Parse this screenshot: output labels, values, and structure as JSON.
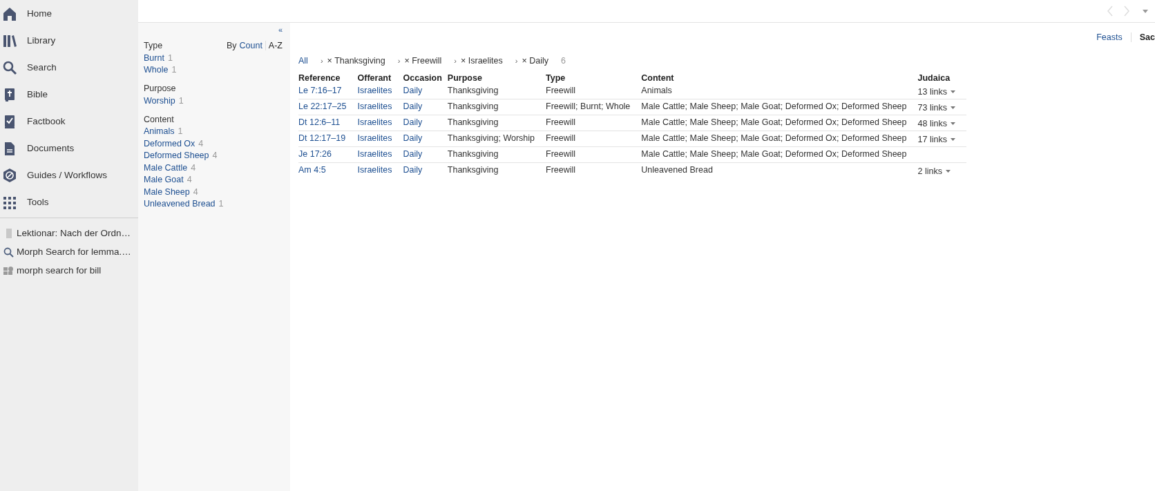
{
  "sidebar": {
    "nav_items": [
      {
        "label": "Home"
      },
      {
        "label": "Library"
      },
      {
        "label": "Search"
      },
      {
        "label": "Bible"
      },
      {
        "label": "Factbook"
      },
      {
        "label": "Documents"
      },
      {
        "label": "Guides / Workflows"
      },
      {
        "label": "Tools"
      }
    ],
    "recent_items": [
      {
        "label": "Lektionar: Nach der Ordn…"
      },
      {
        "label": "Morph Search for lemma.…"
      },
      {
        "label": "morph search for bill"
      }
    ]
  },
  "filter_panel": {
    "collapse": "«",
    "sort_label": "By",
    "sort_options": [
      {
        "label": "Count",
        "selected": false
      },
      {
        "label": "A-Z",
        "selected": true
      }
    ],
    "groups": [
      {
        "title": "Type",
        "items": [
          {
            "label": "Burnt",
            "count": "1"
          },
          {
            "label": "Whole",
            "count": "1"
          }
        ]
      },
      {
        "title": "Purpose",
        "items": [
          {
            "label": "Worship",
            "count": "1"
          }
        ]
      },
      {
        "title": "Content",
        "items": [
          {
            "label": "Animals",
            "count": "1"
          },
          {
            "label": "Deformed Ox",
            "count": "4"
          },
          {
            "label": "Deformed Sheep",
            "count": "4"
          },
          {
            "label": "Male Cattle",
            "count": "4"
          },
          {
            "label": "Male Goat",
            "count": "4"
          },
          {
            "label": "Male Sheep",
            "count": "4"
          },
          {
            "label": "Unleavened Bread",
            "count": "1"
          }
        ]
      }
    ]
  },
  "tabs": [
    {
      "label": "Feasts",
      "selected": false
    },
    {
      "label": "Sac",
      "selected": true
    }
  ],
  "breadcrumb": {
    "root": "All",
    "filters": [
      {
        "separator": "›",
        "label": "× Thanksgiving"
      },
      {
        "separator": "›",
        "label": "× Freewill"
      },
      {
        "separator": "›",
        "label": "× Israelites"
      },
      {
        "separator": "›",
        "label": "× Daily"
      }
    ],
    "count": "6"
  },
  "table": {
    "columns": [
      {
        "label": "Reference",
        "kind": "link"
      },
      {
        "label": "Offerant",
        "kind": "link"
      },
      {
        "label": "Occasion",
        "kind": "link"
      },
      {
        "label": "Purpose",
        "kind": "text"
      },
      {
        "label": "Type",
        "kind": "text"
      },
      {
        "label": "Content",
        "kind": "text"
      },
      {
        "label": "Judaica",
        "kind": "dropdown"
      }
    ],
    "rows": [
      {
        "cells": [
          "Le 7:16–17",
          "Israelites",
          "Daily",
          "Thanksgiving",
          "Freewill",
          "Animals",
          "13 links"
        ]
      },
      {
        "cells": [
          "Le 22:17–25",
          "Israelites",
          "Daily",
          "Thanksgiving",
          "Freewill; Burnt; Whole",
          "Male Cattle; Male Sheep; Male Goat; Deformed Ox; Deformed Sheep",
          "73 links"
        ]
      },
      {
        "cells": [
          "Dt 12:6–11",
          "Israelites",
          "Daily",
          "Thanksgiving",
          "Freewill",
          "Male Cattle; Male Sheep; Male Goat; Deformed Ox; Deformed Sheep",
          "48 links"
        ]
      },
      {
        "cells": [
          "Dt 12:17–19",
          "Israelites",
          "Daily",
          "Thanksgiving; Worship",
          "Freewill",
          "Male Cattle; Male Sheep; Male Goat; Deformed Ox; Deformed Sheep",
          "17 links"
        ]
      },
      {
        "cells": [
          "Je 17:26",
          "Israelites",
          "Daily",
          "Thanksgiving",
          "Freewill",
          "Male Cattle; Male Sheep; Male Goat; Deformed Ox; Deformed Sheep",
          null
        ]
      },
      {
        "cells": [
          "Am 4:5",
          "Israelites",
          "Daily",
          "Thanksgiving",
          "Freewill",
          "Unleavened Bread",
          "2 links"
        ]
      }
    ]
  }
}
